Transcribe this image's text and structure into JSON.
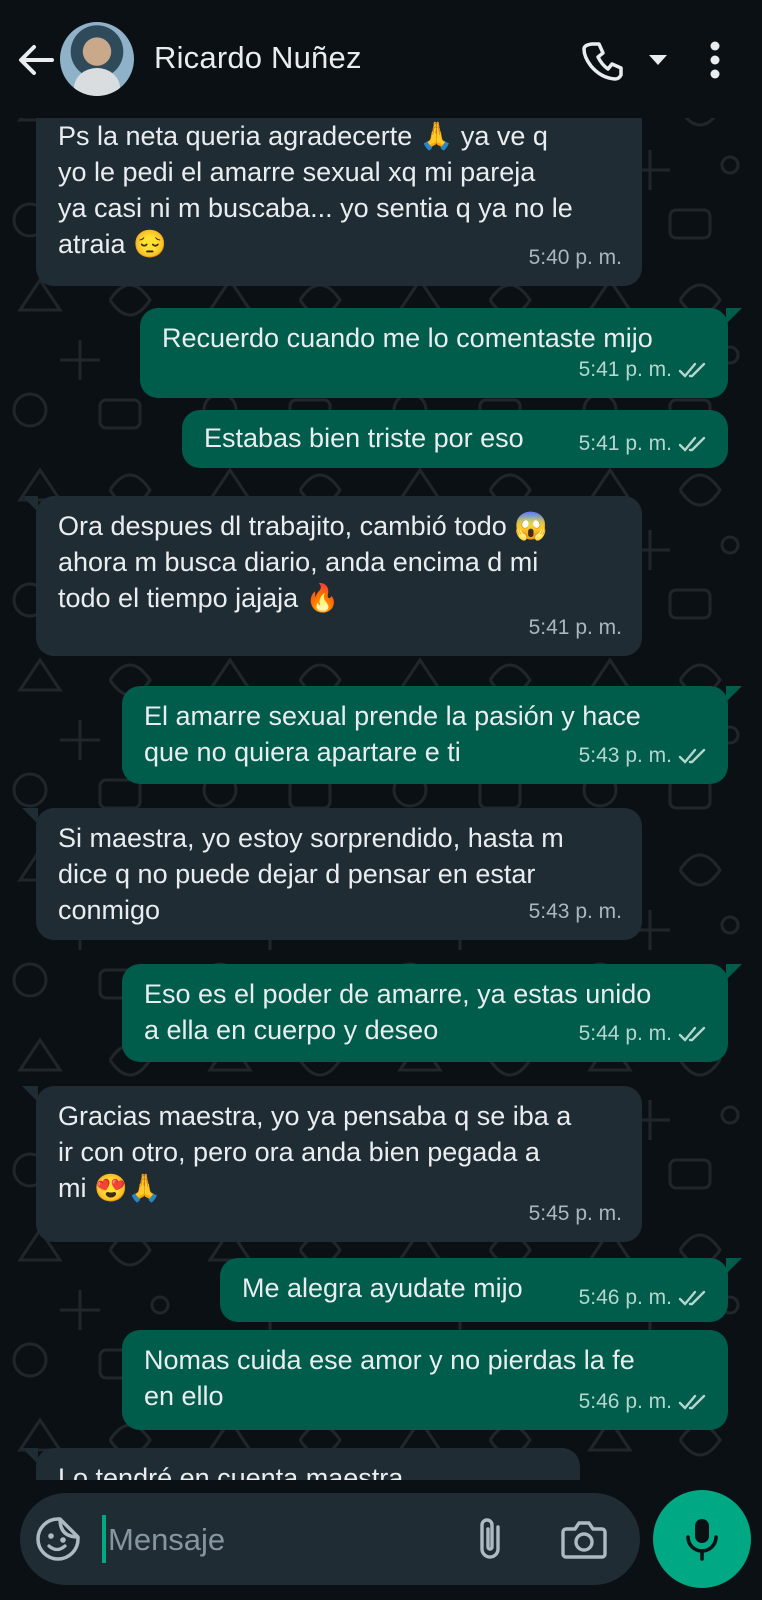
{
  "header": {
    "contact_name": "Ricardo Nuñez"
  },
  "icons": {
    "back": "arrow-left-icon",
    "call": "phone-icon",
    "call_menu": "caret-down-icon",
    "menu": "more-vertical-icon",
    "sticker": "sticker-icon",
    "attach": "paperclip-icon",
    "camera": "camera-icon",
    "mic": "microphone-icon"
  },
  "colors": {
    "background": "#0b1014",
    "incoming_bubble": "#202c33",
    "outgoing_bubble": "#005c4b",
    "accent": "#00a884"
  },
  "messages": [
    {
      "dir": "in",
      "text": "Ps la neta queria agradecerte 🙏  ya ve q\nyo le pedi el amarre sexual xq mi pareja\nya casi ni m buscaba... yo sentia q ya no le\natraia 😔",
      "time": "5:40 p. m."
    },
    {
      "dir": "out",
      "text": "Recuerdo cuando me lo comentaste mijo",
      "time": "5:41 p. m."
    },
    {
      "dir": "out",
      "text": "Estabas bien triste por eso",
      "time": "5:41 p. m."
    },
    {
      "dir": "in",
      "text": "Ora despues dl trabajito, cambió todo 😱\nahora m busca diario, anda encima d mi\ntodo el tiempo jajaja 🔥",
      "time": "5:41 p. m."
    },
    {
      "dir": "out",
      "text": "El amarre sexual prende la pasión y hace\nque no quiera apartare e ti",
      "time": "5:43 p. m."
    },
    {
      "dir": "in",
      "text": "Si maestra, yo estoy sorprendido, hasta m\ndice q no puede dejar d pensar en estar\nconmigo",
      "time": "5:43 p. m."
    },
    {
      "dir": "out",
      "text": "Eso es el poder de amarre, ya estas unido\na ella en cuerpo y deseo",
      "time": "5:44 p. m."
    },
    {
      "dir": "in",
      "text": "Gracias maestra, yo ya pensaba q se iba a\nir con otro, pero ora anda bien pegada a\nmi 😍🙏",
      "time": "5:45 p. m."
    },
    {
      "dir": "out",
      "text": "Me alegra ayudate mijo",
      "time": "5:46 p. m."
    },
    {
      "dir": "out",
      "text": "Nomas cuida ese amor y no pierdas la fe\nen ello",
      "time": "5:46 p. m."
    },
    {
      "dir": "in",
      "text": "Lo tendré en cuenta maestra",
      "time": ""
    }
  ],
  "composer": {
    "placeholder": "Mensaje"
  }
}
